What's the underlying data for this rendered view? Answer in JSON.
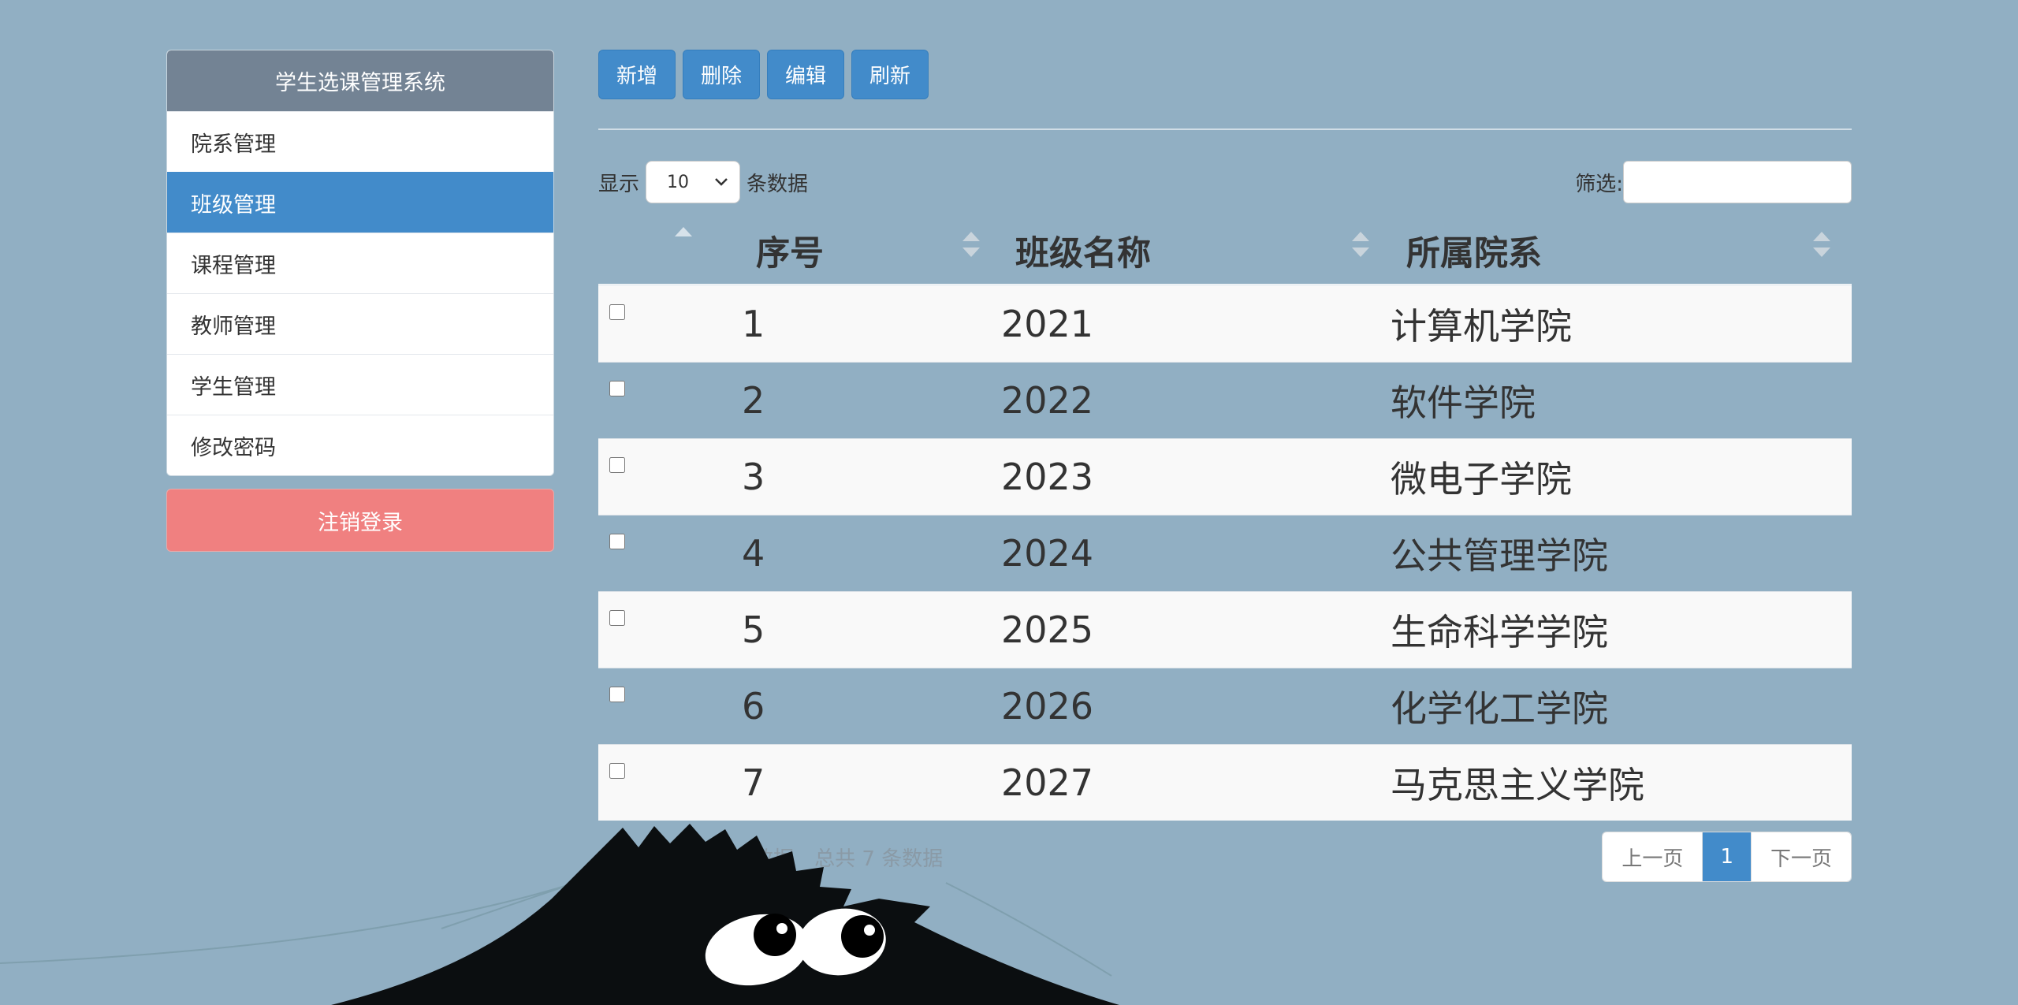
{
  "sidebar": {
    "title": "学生选课管理系统",
    "items": [
      {
        "label": "院系管理",
        "active": false
      },
      {
        "label": "班级管理",
        "active": true
      },
      {
        "label": "课程管理",
        "active": false
      },
      {
        "label": "教师管理",
        "active": false
      },
      {
        "label": "学生管理",
        "active": false
      },
      {
        "label": "修改密码",
        "active": false
      }
    ],
    "logout_label": "注销登录"
  },
  "toolbar": {
    "add_label": "新增",
    "delete_label": "删除",
    "edit_label": "编辑",
    "refresh_label": "刷新"
  },
  "controls": {
    "show_prefix": "显示",
    "page_size": "10",
    "show_suffix": "条数据",
    "filter_label": "筛选:",
    "filter_value": ""
  },
  "table": {
    "columns": [
      "序号",
      "班级名称",
      "所属院系"
    ],
    "rows": [
      {
        "id": "1",
        "name": "2021",
        "dept": "计算机学院"
      },
      {
        "id": "2",
        "name": "2022",
        "dept": "软件学院"
      },
      {
        "id": "3",
        "name": "2023",
        "dept": "微电子学院"
      },
      {
        "id": "4",
        "name": "2024",
        "dept": "公共管理学院"
      },
      {
        "id": "5",
        "name": "2025",
        "dept": "生命科学学院"
      },
      {
        "id": "6",
        "name": "2026",
        "dept": "化学化工学院"
      },
      {
        "id": "7",
        "name": "2027",
        "dept": "马克思主义学院"
      }
    ]
  },
  "footer": {
    "info": "当前第 1 至 7 条数据　总共 7 条数据",
    "prev_label": "上一页",
    "current_page": "1",
    "next_label": "下一页"
  },
  "colors": {
    "background": "#91afc3",
    "primary": "#428bca",
    "sidebar_header": "#738394",
    "logout": "#f08080"
  }
}
